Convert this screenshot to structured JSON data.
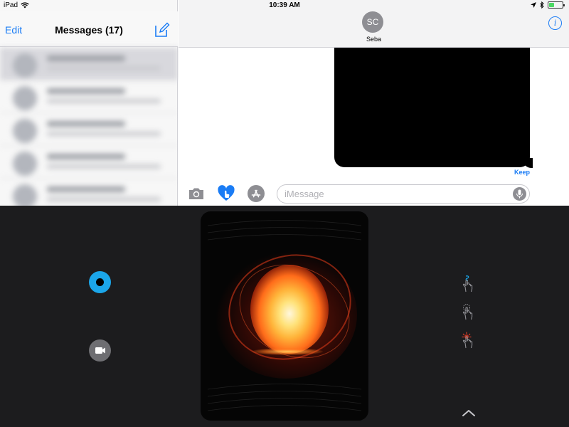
{
  "status_bar": {
    "device": "iPad",
    "time": "10:39 AM"
  },
  "conversation_list": {
    "edit_label": "Edit",
    "title": "Messages (17)"
  },
  "conversation": {
    "contact_initials": "SC",
    "contact_name": "Seba",
    "keep_label": "Keep",
    "input_placeholder": "iMessage"
  },
  "colors": {
    "accent": "#1a7cf5",
    "record": "#1ba6ea",
    "drawer_background": "#1c1c1e",
    "battery": "#4cd964"
  },
  "icons": {
    "wifi": "wifi-icon",
    "location": "location-arrow-icon",
    "bluetooth": "bluetooth-icon",
    "battery": "battery-icon",
    "compose": "compose-icon",
    "info": "info-icon",
    "camera": "camera-icon",
    "digital_touch": "digital-touch-icon",
    "app_store": "app-store-icon",
    "microphone": "microphone-icon",
    "record": "record-icon",
    "video": "video-camera-icon",
    "sketch_gesture": "sketch-gesture-icon",
    "tap_gesture": "tap-gesture-icon",
    "heartbeat_gesture": "heartbeat-gesture-icon",
    "expand": "chevron-up-icon"
  },
  "battery_level": 0.4
}
